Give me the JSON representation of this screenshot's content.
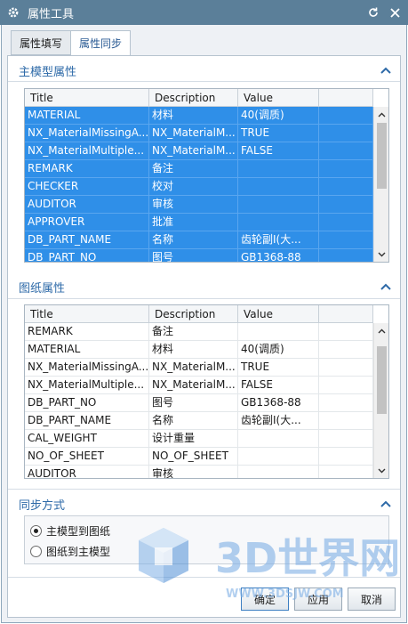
{
  "window": {
    "title": "属性工具",
    "icons": {
      "app": "gear-icon",
      "reset": "reset-icon",
      "close": "close-icon"
    }
  },
  "tabs": [
    {
      "label": "属性填写",
      "active": false
    },
    {
      "label": "属性同步",
      "active": true
    }
  ],
  "columns": {
    "title": "Title",
    "description": "Description",
    "value": "Value"
  },
  "master_section": {
    "header": "主模型属性",
    "rows": [
      {
        "title": "MATERIAL",
        "description": "材料",
        "value": "40(调质)"
      },
      {
        "title": "NX_MaterialMissingA...",
        "description": "NX_MaterialM...",
        "value": "TRUE"
      },
      {
        "title": "NX_MaterialMultiple...",
        "description": "NX_MaterialM...",
        "value": "FALSE"
      },
      {
        "title": "REMARK",
        "description": "备注",
        "value": ""
      },
      {
        "title": "CHECKER",
        "description": "校对",
        "value": ""
      },
      {
        "title": "AUDITOR",
        "description": "审核",
        "value": ""
      },
      {
        "title": "APPROVER",
        "description": "批准",
        "value": ""
      },
      {
        "title": "DB_PART_NAME",
        "description": "名称",
        "value": "齿轮副Ⅰ(大..."
      },
      {
        "title": "DB_PART_NO",
        "description": "图号",
        "value": "GB1368-88"
      }
    ]
  },
  "drawing_section": {
    "header": "图纸属性",
    "rows": [
      {
        "title": "REMARK",
        "description": "备注",
        "value": ""
      },
      {
        "title": "MATERIAL",
        "description": "材料",
        "value": "40(调质)"
      },
      {
        "title": "NX_MaterialMissingA...",
        "description": "NX_MaterialM...",
        "value": "TRUE"
      },
      {
        "title": "NX_MaterialMultiple...",
        "description": "NX_MaterialM...",
        "value": "FALSE"
      },
      {
        "title": "DB_PART_NO",
        "description": "图号",
        "value": "GB1368-88"
      },
      {
        "title": "DB_PART_NAME",
        "description": "名称",
        "value": "齿轮副Ⅰ(大..."
      },
      {
        "title": "CAL_WEIGHT",
        "description": "设计重量",
        "value": ""
      },
      {
        "title": "NO_OF_SHEET",
        "description": "NO_OF_SHEET",
        "value": ""
      },
      {
        "title": "AUDITOR",
        "description": "审核",
        "value": ""
      }
    ]
  },
  "sync_section": {
    "header": "同步方式",
    "options": [
      {
        "label": "主模型到图纸",
        "selected": true
      },
      {
        "label": "图纸到主模型",
        "selected": false
      }
    ]
  },
  "buttons": {
    "ok": "确定",
    "apply": "应用",
    "cancel": "取消"
  },
  "watermark": {
    "brand": "3D世界网",
    "url": "WWW.3DSJW.COM"
  },
  "colors": {
    "titlebar": "#5b7f99",
    "selection": "#2f8fe8",
    "section_header": "#2e6aa8"
  }
}
